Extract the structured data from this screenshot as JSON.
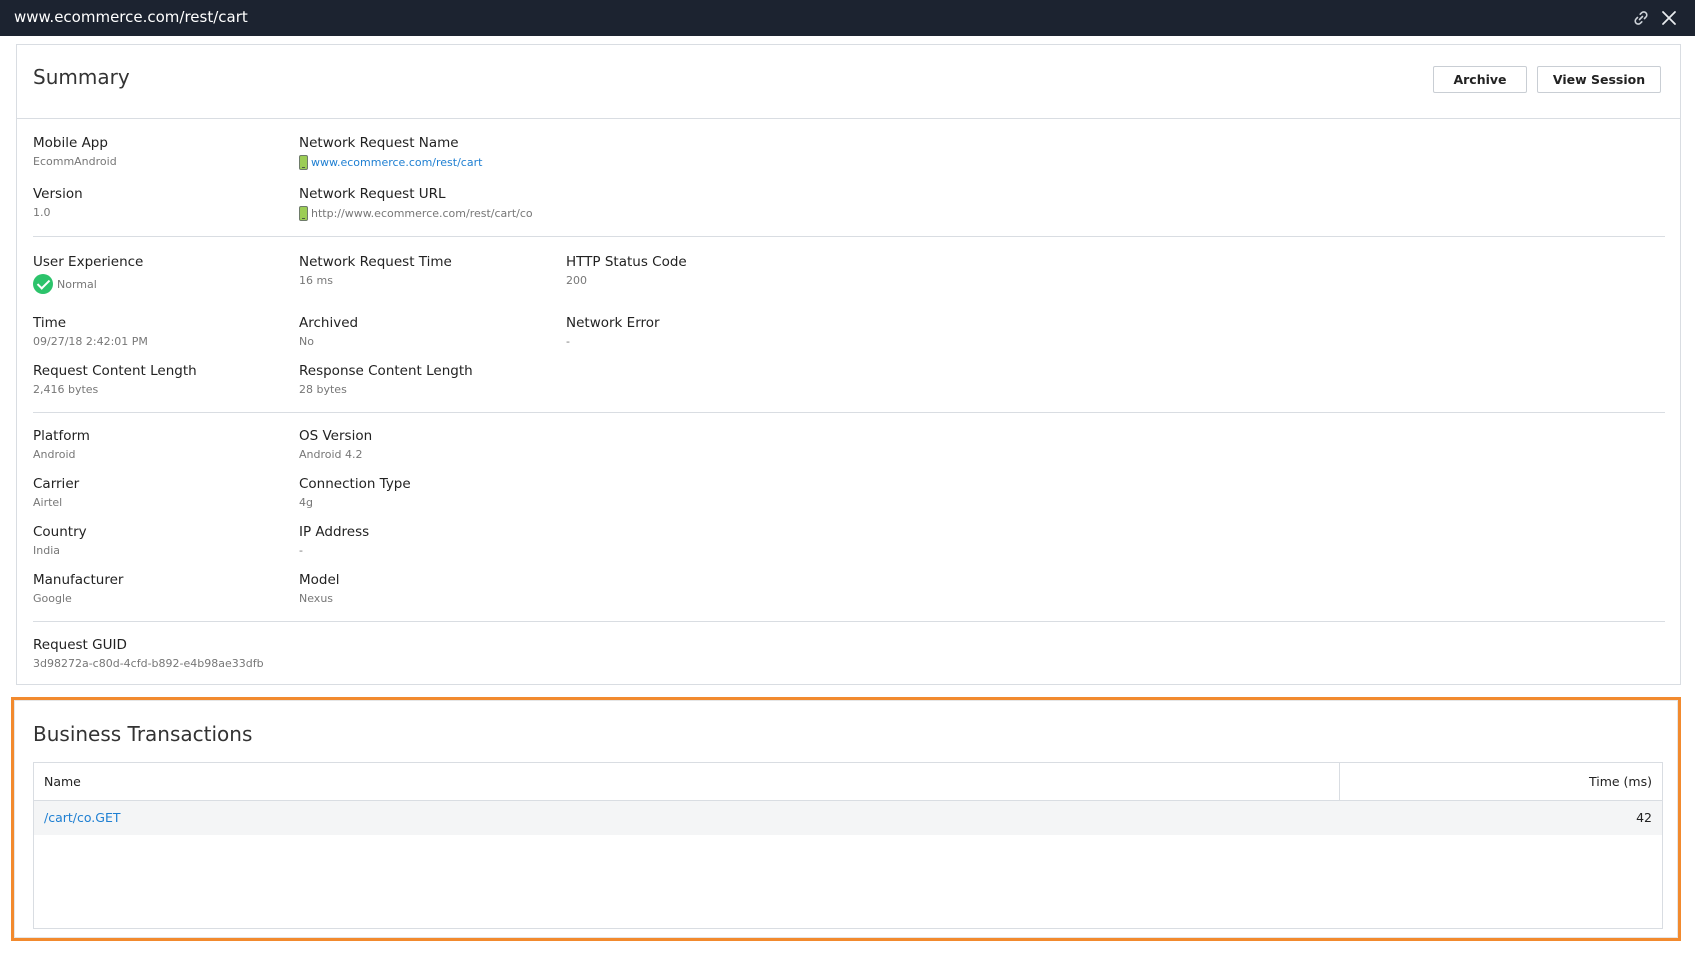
{
  "window": {
    "title": "www.ecommerce.com/rest/cart"
  },
  "summary": {
    "title": "Summary",
    "archive_label": "Archive",
    "view_session_label": "View Session",
    "mobile_app": {
      "label": "Mobile App",
      "value": "EcommAndroid"
    },
    "version": {
      "label": "Version",
      "value": "1.0"
    },
    "network_request_name": {
      "label": "Network Request Name",
      "value": "www.ecommerce.com/rest/cart"
    },
    "network_request_url": {
      "label": "Network Request URL",
      "value": "http://www.ecommerce.com/rest/cart/co"
    },
    "user_experience": {
      "label": "User Experience",
      "value": "Normal"
    },
    "network_request_time": {
      "label": "Network Request Time",
      "value": "16 ms"
    },
    "http_status_code": {
      "label": "HTTP Status Code",
      "value": "200"
    },
    "time": {
      "label": "Time",
      "value": "09/27/18 2:42:01 PM"
    },
    "archived": {
      "label": "Archived",
      "value": "No"
    },
    "network_error": {
      "label": "Network Error",
      "value": "-"
    },
    "request_content_length": {
      "label": "Request Content Length",
      "value": "2,416 bytes"
    },
    "response_content_length": {
      "label": "Response Content Length",
      "value": "28 bytes"
    },
    "platform": {
      "label": "Platform",
      "value": "Android"
    },
    "os_version": {
      "label": "OS Version",
      "value": "Android 4.2"
    },
    "carrier": {
      "label": "Carrier",
      "value": "Airtel"
    },
    "connection_type": {
      "label": "Connection Type",
      "value": "4g"
    },
    "country": {
      "label": "Country",
      "value": "India"
    },
    "ip_address": {
      "label": "IP Address",
      "value": "-"
    },
    "manufacturer": {
      "label": "Manufacturer",
      "value": "Google"
    },
    "model": {
      "label": "Model",
      "value": "Nexus"
    },
    "request_guid": {
      "label": "Request GUID",
      "value": "3d98272a-c80d-4cfd-b892-e4b98ae33dfb"
    }
  },
  "business_transactions": {
    "title": "Business Transactions",
    "columns": [
      "Name",
      "Time (ms)"
    ],
    "rows": [
      {
        "name": "/cart/co.GET",
        "time": "42"
      }
    ]
  },
  "colors": {
    "titlebar": "#1c2330",
    "link": "#1e7fd2",
    "highlight_border": "#f28a2e",
    "status_ok": "#2cc36b"
  },
  "icons": {
    "link": "link-icon",
    "close": "close-icon",
    "device": "mobile-device-icon",
    "status": "check-circle-icon"
  }
}
